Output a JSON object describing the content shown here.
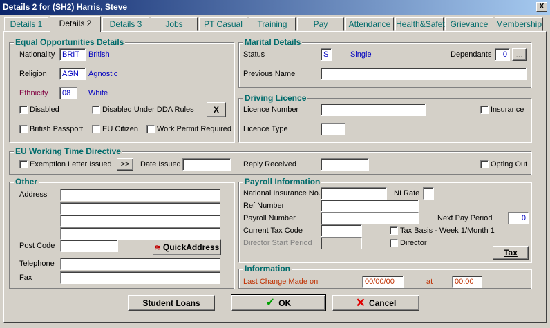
{
  "window": {
    "title": "Details 2 for (SH2) Harris, Steve",
    "close_label": "X"
  },
  "tabs": [
    "Details 1",
    "Details 2",
    "Details 3",
    "Jobs",
    "PT Casual",
    "Training",
    "Pay",
    "Attendance",
    "Health&Safety",
    "Grievance",
    "Membership"
  ],
  "active_tab": "Details 2",
  "equal_opps": {
    "title": "Equal Opportunities Details",
    "nationality_label": "Nationality",
    "nationality_code": "BRIT",
    "nationality_value": "British",
    "religion_label": "Religion",
    "religion_code": "AGN",
    "religion_value": "Agnostic",
    "ethnicity_label": "Ethnicity",
    "ethnicity_code": "08",
    "ethnicity_value": "White",
    "disabled_label": "Disabled",
    "disabled_dda_label": "Disabled Under DDA Rules",
    "clear_button": "X",
    "british_passport_label": "British Passport",
    "eu_citizen_label": "EU Citizen",
    "work_permit_label": "Work Permit Required"
  },
  "marital": {
    "title": "Marital Details",
    "status_label": "Status",
    "status_code": "S",
    "status_value": "Single",
    "dependants_label": "Dependants",
    "dependants_value": "0",
    "dependants_button": "...",
    "previous_name_label": "Previous Name",
    "previous_name_value": ""
  },
  "driving": {
    "title": "Driving Licence",
    "licence_number_label": "Licence Number",
    "licence_number_value": "",
    "insurance_label": "Insurance",
    "licence_type_label": "Licence Type",
    "licence_type_value": ""
  },
  "eu_wtd": {
    "title": "EU Working Time Directive",
    "exemption_label": "Exemption Letter Issued",
    "arrow_button": ">>",
    "date_issued_label": "Date Issued",
    "date_issued_value": "",
    "reply_received_label": "Reply Received",
    "reply_received_value": "",
    "opting_out_label": "Opting Out"
  },
  "other": {
    "title": "Other",
    "address_label": "Address",
    "address_lines": [
      "",
      "",
      "",
      ""
    ],
    "post_code_label": "Post Code",
    "post_code_value": "",
    "quickaddress_button": "QuickAddress",
    "telephone_label": "Telephone",
    "telephone_value": "",
    "fax_label": "Fax",
    "fax_value": ""
  },
  "payroll": {
    "title": "Payroll Information",
    "ni_label": "National Insurance No.",
    "ni_value": "",
    "ni_rate_label": "NI Rate",
    "ni_rate_value": "",
    "ref_number_label": "Ref Number",
    "ref_number_value": "",
    "payroll_number_label": "Payroll Number",
    "payroll_number_value": "",
    "next_pay_period_label": "Next Pay Period",
    "next_pay_period_value": "0",
    "current_tax_code_label": "Current Tax Code",
    "current_tax_code_value": "",
    "tax_basis_label": "Tax Basis - Week 1/Month 1",
    "director_start_label": "Director Start Period",
    "director_start_value": "",
    "director_label": "Director",
    "tax_button": "Tax"
  },
  "information": {
    "title": "Information",
    "last_change_label": "Last Change Made on",
    "last_change_date": "00/00/00",
    "at_label": "at",
    "last_change_time": "00:00"
  },
  "footer": {
    "student_loans_button": "Student Loans",
    "ok_button": "OK",
    "cancel_button": "Cancel"
  },
  "colors": {
    "title_gradient_start": "#0a246a",
    "title_gradient_end": "#a6caf0",
    "group_title": "#006b6b",
    "value_blue": "#0000c0",
    "info_red": "#c03000"
  }
}
